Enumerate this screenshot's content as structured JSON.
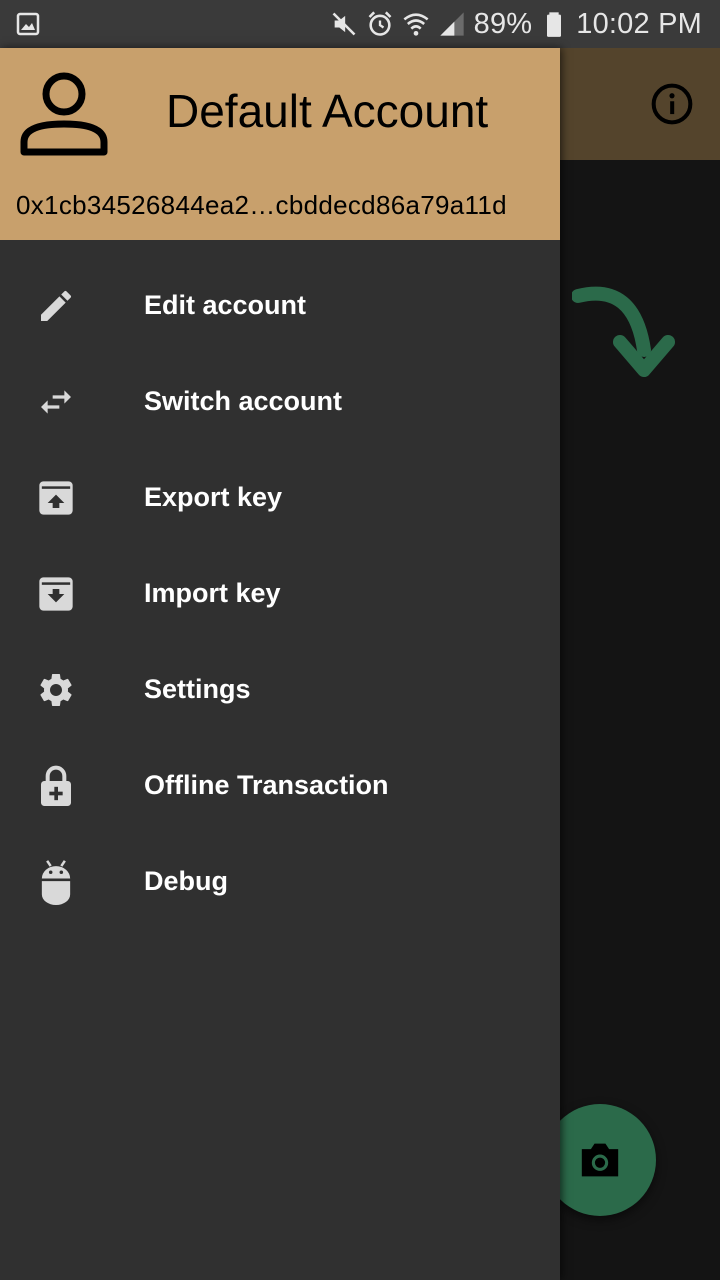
{
  "status_bar": {
    "battery": "89%",
    "time": "10:02 PM"
  },
  "drawer": {
    "account_name": "Default Account",
    "account_address": "0x1cb34526844ea2…cbddecd86a79a11d",
    "items": [
      {
        "label": "Edit account",
        "icon": "pencil-icon"
      },
      {
        "label": "Switch account",
        "icon": "swap-arrows-icon"
      },
      {
        "label": "Export key",
        "icon": "archive-upload-icon"
      },
      {
        "label": "Import key",
        "icon": "archive-download-icon"
      },
      {
        "label": "Settings",
        "icon": "gear-icon"
      },
      {
        "label": "Offline Transaction",
        "icon": "lock-plus-icon"
      },
      {
        "label": "Debug",
        "icon": "android-icon"
      }
    ]
  },
  "colors": {
    "header": "#c8a06c",
    "drawer_bg": "#303030",
    "app_bar": "#54442c",
    "accent_green": "#2b6a4a",
    "icon_gray": "#d9d9d9"
  }
}
